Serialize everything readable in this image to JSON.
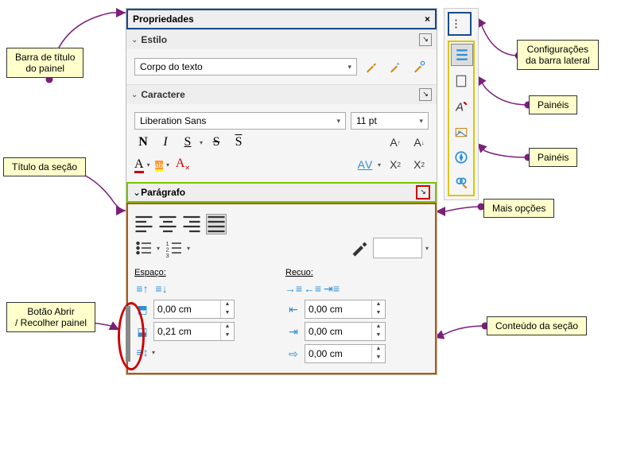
{
  "titlebar": {
    "title": "Propriedades"
  },
  "style": {
    "header": "Estilo",
    "combo": "Corpo do texto"
  },
  "char": {
    "header": "Caractere",
    "font": "Liberation Sans",
    "size": "11 pt",
    "bold": "N",
    "italic": "I",
    "underline": "S",
    "strike": "S",
    "overline": "S",
    "grow": "A↑",
    "shrink": "A↓",
    "fontcolor": "A",
    "highlight": "ab",
    "clearfmt": "A",
    "spacing": "AV",
    "superscript": "X²",
    "subscript": "X₂"
  },
  "para": {
    "header": "Parágrafo",
    "space_label": "Espaço:",
    "indent_label": "Recuo:",
    "spinner_above": "0,00 cm",
    "spinner_below": "0,21 cm",
    "spinner_left": "0,00 cm",
    "spinner_right": "0,00 cm",
    "spinner_first": "0,00 cm"
  },
  "callouts": {
    "title": "Barra de título\ndo painel",
    "section_title": "Título da seção",
    "collapse": "Botão Abrir\n/ Recolher painel",
    "sidebar_cfg": "Configurações\nda barra lateral",
    "panels1": "Painéis",
    "panels2": "Painéis",
    "more": "Mais opções",
    "content": "Conteúdo da seção"
  },
  "colors": {
    "connector": "#7b1f7b",
    "blue": "#1a4b8c",
    "yellow": "#d9c800",
    "green": "#7bc400",
    "red": "#cc0000",
    "brown": "#b35900"
  }
}
